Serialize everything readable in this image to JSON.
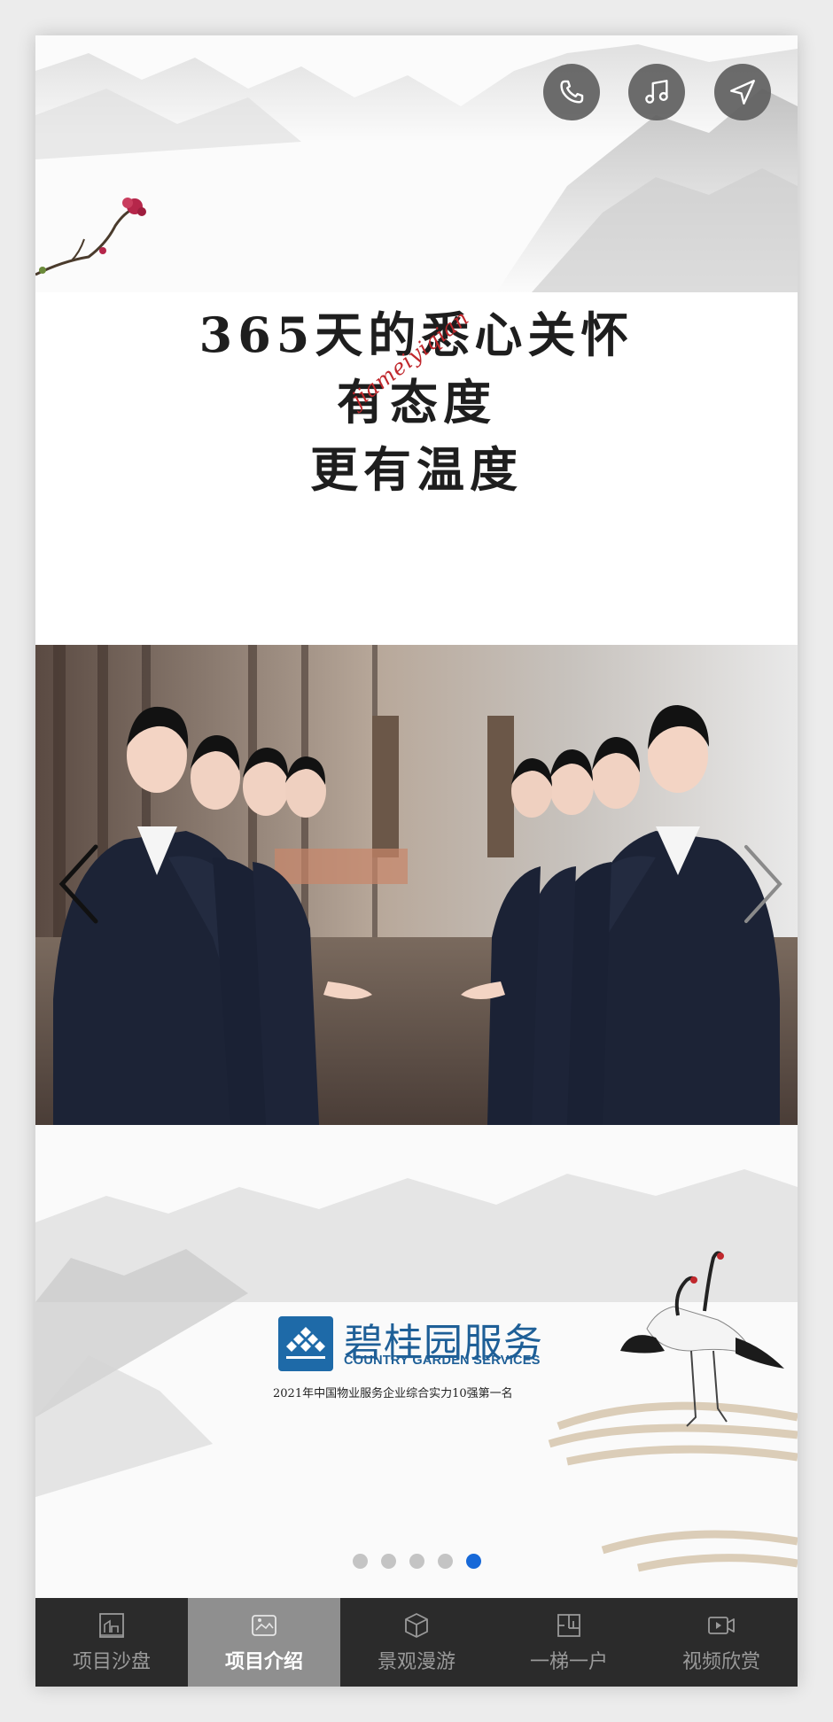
{
  "header": {
    "actions": [
      {
        "icon": "phone-icon"
      },
      {
        "icon": "music-icon"
      },
      {
        "icon": "navigation-icon"
      }
    ]
  },
  "headline": {
    "line1": "365天的悉心关怀",
    "line2": "有态度",
    "line3": "更有温度"
  },
  "watermark": "jiameiyiqian",
  "carousel": {
    "prev_icon": "chevron-left-icon",
    "next_icon": "chevron-right-icon",
    "slide_count": 5,
    "active_index": 4
  },
  "brand": {
    "name": "碧桂园服务",
    "english": "COUNTRY GARDEN SERVICES",
    "tagline": "2021年中国物业服务企业综合实力10强第一名"
  },
  "tabs": [
    {
      "label": "项目沙盘",
      "icon": "sandbox-icon",
      "active": false
    },
    {
      "label": "项目介绍",
      "icon": "intro-icon",
      "active": true
    },
    {
      "label": "景观漫游",
      "icon": "cube-icon",
      "active": false
    },
    {
      "label": "一梯一户",
      "icon": "floorplan-icon",
      "active": false
    },
    {
      "label": "视频欣赏",
      "icon": "video-icon",
      "active": false
    }
  ],
  "colors": {
    "tabbar_bg": "#2b2b2b",
    "tab_active_bg": "#8f8f8f",
    "dot_active": "#1769d8",
    "brand_blue": "#1e6aa8"
  }
}
